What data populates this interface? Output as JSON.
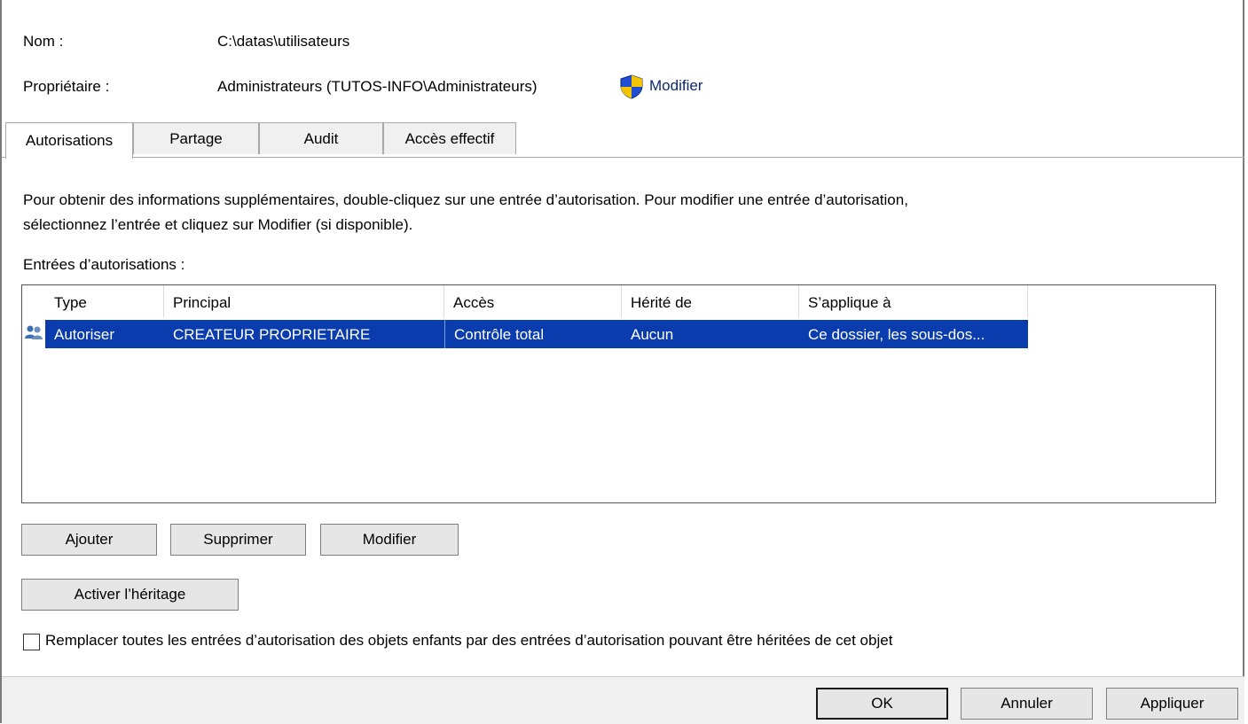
{
  "header": {
    "name_label": "Nom :",
    "name_value": "C:\\datas\\utilisateurs",
    "owner_label": "Propriétaire :",
    "owner_value": "Administrateurs (TUTOS-INFO\\Administrateurs)",
    "owner_change": "Modifier"
  },
  "tabs": [
    {
      "label": "Autorisations",
      "active": true
    },
    {
      "label": "Partage",
      "active": false
    },
    {
      "label": "Audit",
      "active": false
    },
    {
      "label": "Accès effectif",
      "active": false
    }
  ],
  "description": {
    "line1": "Pour obtenir des informations supplémentaires, double-cliquez sur une entrée d’autorisation. Pour modifier une entrée d’autorisation,",
    "line2": "sélectionnez l’entrée et cliquez sur Modifier (si disponible)."
  },
  "entries": {
    "label": "Entrées d’autorisations :",
    "columns": [
      "Type",
      "Principal",
      "Accès",
      "Hérité de",
      "S’applique à"
    ],
    "rows": [
      {
        "type": "Autoriser",
        "principal": "CREATEUR PROPRIETAIRE",
        "access": "Contrôle total",
        "inherited": "Aucun",
        "applies": "Ce dossier, les sous-dos...",
        "selected": true
      }
    ]
  },
  "buttons": {
    "add": "Ajouter",
    "remove": "Supprimer",
    "edit": "Modifier",
    "enable_inheritance": "Activer l’héritage"
  },
  "replace_checkbox": {
    "label": "Remplacer toutes les entrées d’autorisation des objets enfants par des entrées d’autorisation pouvant être héritées de cet objet",
    "checked": false
  },
  "footer": {
    "ok": "OK",
    "cancel": "Annuler",
    "apply": "Appliquer"
  },
  "colors": {
    "selection": "#0a3cad",
    "shield_blue": "#1f4fd0",
    "shield_yellow": "#f3c400"
  }
}
